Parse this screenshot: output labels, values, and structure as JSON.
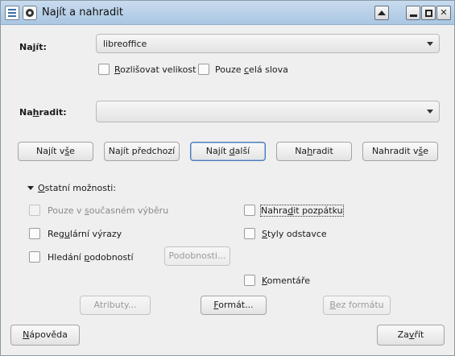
{
  "window": {
    "title": "Najít a nahradit",
    "icons": [
      "document-icon",
      "app-menu-icon"
    ],
    "controls": [
      "roll-up-icon",
      "minimize-icon",
      "maximize-icon",
      "close-icon"
    ]
  },
  "find": {
    "label_pre": "Na",
    "label_key": "j",
    "label_post": "ít:",
    "value": "libreoffice",
    "match_case_pre": "",
    "match_case_key": "R",
    "match_case_post": "ozlišovat velikost",
    "whole_words_pre": "Pouze ",
    "whole_words_key": "c",
    "whole_words_post": "elá slova"
  },
  "replace": {
    "label_pre": "Na",
    "label_key": "h",
    "label_post": "radit:",
    "value": ""
  },
  "buttons": {
    "find_all_pre": "Najít v",
    "find_all_key": "š",
    "find_all_post": "e",
    "find_prev": "Najít předchozí",
    "find_next_pre": "Najít ",
    "find_next_key": "d",
    "find_next_post": "alší",
    "replace_pre": "Na",
    "replace_key": "h",
    "replace_post": "radit",
    "replace_all_pre": "Nahradit v",
    "replace_all_key": "š",
    "replace_all_post": "e"
  },
  "other_options": {
    "label_pre": "",
    "label_key": "O",
    "label_post": "statní možnosti:",
    "expanded": true,
    "current_selection_pre": "Pouze v ",
    "current_selection_key": "s",
    "current_selection_post": "oučasném výběru",
    "backwards_pre": "Nahra",
    "backwards_key": "d",
    "backwards_post": "it pozpátku",
    "regex_pre": "Reg",
    "regex_key": "u",
    "regex_post": "lární výrazy",
    "para_styles_pre": "",
    "para_styles_key": "S",
    "para_styles_post": "tyly odstavce",
    "similarity_pre": "Hledání ",
    "similarity_key": "p",
    "similarity_post": "odobností",
    "similarity_btn": "Podobnosti...",
    "comments_pre": "",
    "comments_key": "K",
    "comments_post": "omentáře",
    "attributes_btn": "Atributy...",
    "format_btn_pre": "",
    "format_btn_key": "F",
    "format_btn_post": "ormát...",
    "no_format_btn_pre": "",
    "no_format_btn_key": "B",
    "no_format_btn_post": "ez formátu"
  },
  "footer": {
    "help_pre": "",
    "help_key": "N",
    "help_post": "ápověda",
    "close_pre": "Za",
    "close_key": "v",
    "close_post": "řít"
  }
}
